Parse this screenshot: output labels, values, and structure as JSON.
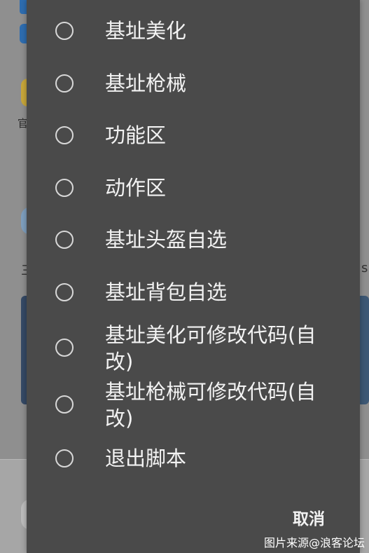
{
  "background": {
    "side_text_left": "官",
    "side_text_san": "三",
    "side_text_right": "s"
  },
  "dialog": {
    "options": [
      {
        "label": "基址美化"
      },
      {
        "label": "基址枪械"
      },
      {
        "label": "功能区"
      },
      {
        "label": "动作区"
      },
      {
        "label": "基址头盔自选"
      },
      {
        "label": "基址背包自选"
      },
      {
        "label": "基址美化可修改代码(自改)"
      },
      {
        "label": "基址枪械可修改代码(自改)"
      },
      {
        "label": "退出脚本"
      }
    ],
    "cancel_label": "取消"
  },
  "watermark": "图片来源@浪客论坛"
}
